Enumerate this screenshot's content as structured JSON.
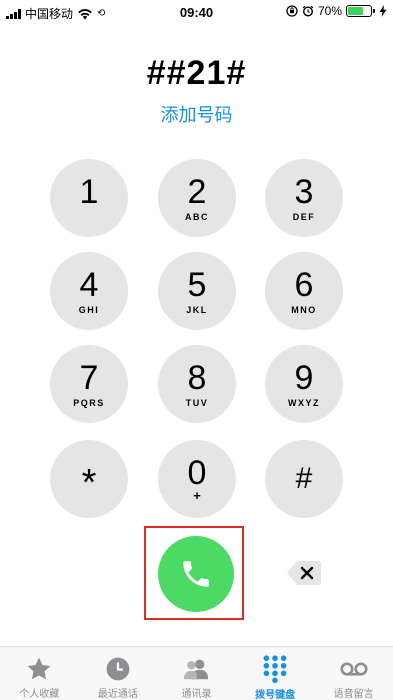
{
  "status_bar": {
    "carrier": "中国移动",
    "time": "09:40",
    "battery_percent": "70%",
    "battery_level": 0.7,
    "battery_color": "#3bd35a"
  },
  "dialer": {
    "number": "##21#",
    "add_number_label": "添加号码",
    "accent_color": "#1a8fde",
    "keys": [
      {
        "digit": "1",
        "letters": ""
      },
      {
        "digit": "2",
        "letters": "ABC"
      },
      {
        "digit": "3",
        "letters": "DEF"
      },
      {
        "digit": "4",
        "letters": "GHI"
      },
      {
        "digit": "5",
        "letters": "JKL"
      },
      {
        "digit": "6",
        "letters": "MNO"
      },
      {
        "digit": "7",
        "letters": "PQRS"
      },
      {
        "digit": "8",
        "letters": "TUV"
      },
      {
        "digit": "9",
        "letters": "WXYZ"
      },
      {
        "digit": "*",
        "letters": ""
      },
      {
        "digit": "0",
        "letters": "+"
      },
      {
        "digit": "#",
        "letters": ""
      }
    ],
    "call_icon": "phone-icon",
    "call_color": "#4cd964",
    "delete_icon": "backspace-icon"
  },
  "tab_bar": {
    "tabs": [
      {
        "label": "个人收藏",
        "icon": "star-icon"
      },
      {
        "label": "最近通话",
        "icon": "clock-icon"
      },
      {
        "label": "通讯录",
        "icon": "contacts-icon"
      },
      {
        "label": "拨号键盘",
        "icon": "keypad-icon",
        "active": true
      },
      {
        "label": "语音留言",
        "icon": "voicemail-icon"
      }
    ]
  }
}
